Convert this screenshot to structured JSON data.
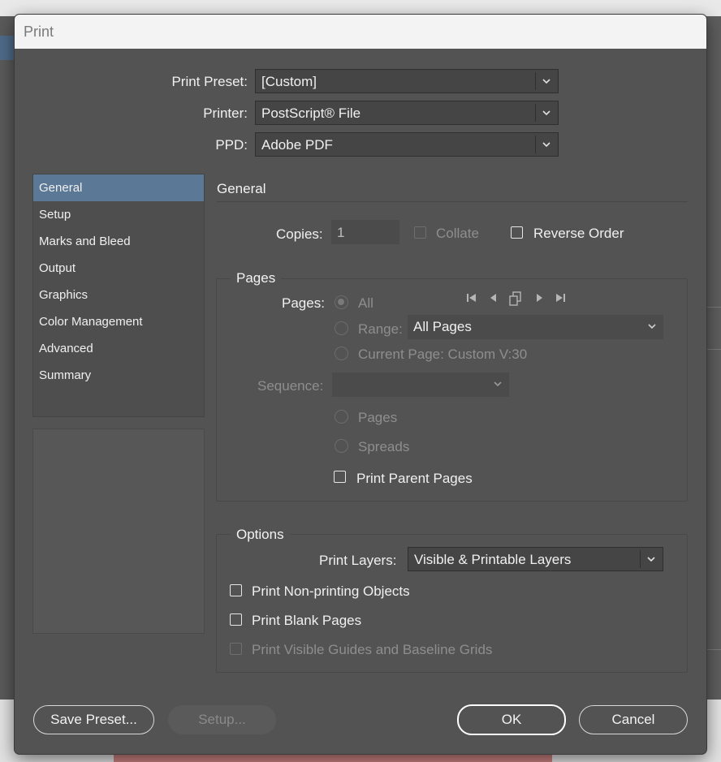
{
  "dialog": {
    "title": "Print"
  },
  "preset": {
    "print_preset_label": "Print Preset:",
    "print_preset_value": "[Custom]",
    "printer_label": "Printer:",
    "printer_value": "PostScript® File",
    "ppd_label": "PPD:",
    "ppd_value": "Adobe PDF"
  },
  "nav": {
    "items": [
      {
        "label": "General",
        "selected": true
      },
      {
        "label": "Setup"
      },
      {
        "label": "Marks and Bleed"
      },
      {
        "label": "Output"
      },
      {
        "label": "Graphics"
      },
      {
        "label": "Color Management"
      },
      {
        "label": "Advanced"
      },
      {
        "label": "Summary"
      }
    ]
  },
  "general": {
    "heading": "General",
    "copies_label": "Copies:",
    "copies_value": "1",
    "collate_label": "Collate",
    "collate_checked": false,
    "reverse_order_label": "Reverse Order",
    "reverse_order_checked": false
  },
  "pages": {
    "heading": "Pages",
    "pages_label": "Pages:",
    "all_label": "All",
    "range_label": "Range:",
    "range_value": "All Pages",
    "current_page_label": "Current Page: Custom V:30",
    "sequence_label": "Sequence:",
    "sequence_value": "",
    "pages_option_label": "Pages",
    "spreads_option_label": "Spreads",
    "print_parent_pages_label": "Print Parent Pages",
    "print_parent_pages_checked": false,
    "selected_option": "All"
  },
  "options": {
    "heading": "Options",
    "print_layers_label": "Print Layers:",
    "print_layers_value": "Visible & Printable Layers",
    "non_printing_label": "Print Non-printing Objects",
    "blank_pages_label": "Print Blank Pages",
    "visible_guides_label": "Print Visible Guides and Baseline Grids"
  },
  "buttons": {
    "save_preset": "Save Preset...",
    "setup": "Setup...",
    "ok": "OK",
    "cancel": "Cancel"
  },
  "colors": {
    "dialog_bg": "#535353",
    "selection": "#5b7896",
    "text": "#f0f0f0",
    "disabled_text": "#8e8e8e"
  }
}
